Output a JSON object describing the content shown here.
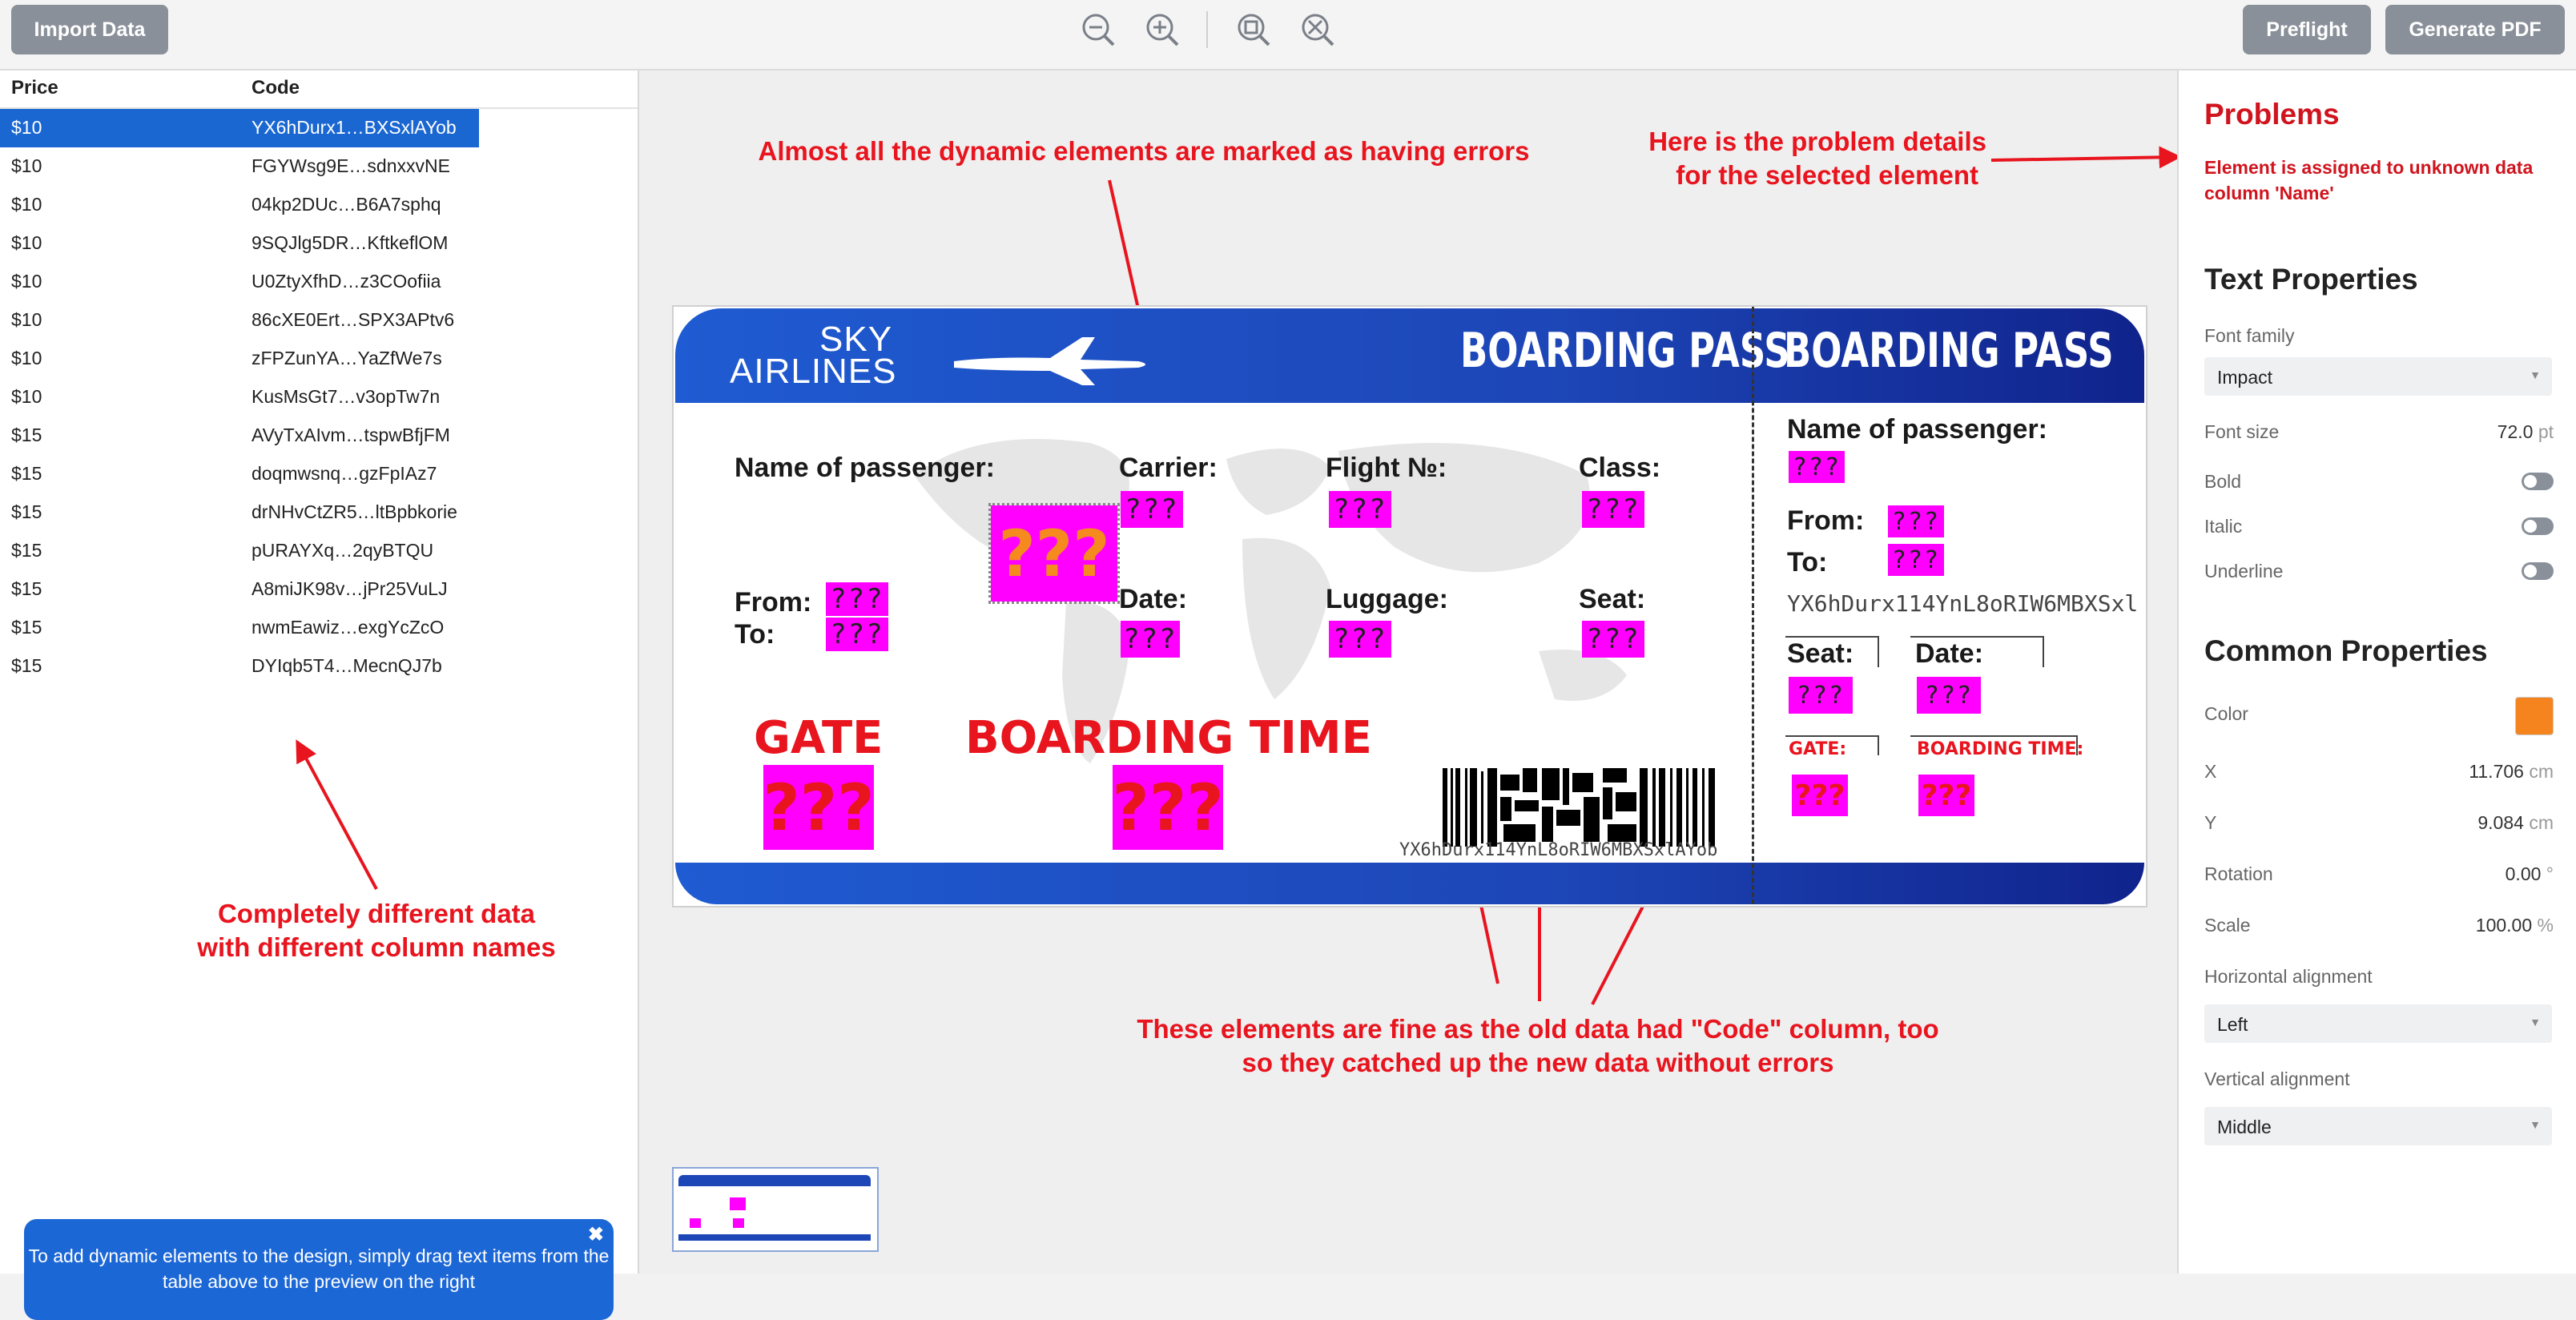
{
  "toolbar": {
    "import_label": "Import Data",
    "preflight_label": "Preflight",
    "generate_label": "Generate PDF",
    "icons": [
      "zoom-out-icon",
      "zoom-in-icon",
      "zoom-fit-icon",
      "zoom-actual-icon"
    ]
  },
  "table": {
    "headers": [
      "Price",
      "Code"
    ],
    "rows": [
      {
        "price": "$10",
        "code": "YX6hDurx1…BXSxlAYob"
      },
      {
        "price": "$10",
        "code": "FGYWsg9E…sdnxxvNE"
      },
      {
        "price": "$10",
        "code": "04kp2DUc…B6A7sphq"
      },
      {
        "price": "$10",
        "code": "9SQJlg5DR…KftkeflOM"
      },
      {
        "price": "$10",
        "code": "U0ZtyXfhD…z3COofiia"
      },
      {
        "price": "$10",
        "code": "86cXE0Ert…SPX3APtv6"
      },
      {
        "price": "$10",
        "code": "zFPZunYA…YaZfWe7s"
      },
      {
        "price": "$10",
        "code": "KusMsGt7…v3opTw7n"
      },
      {
        "price": "$15",
        "code": "AVyTxAIvm…tspwBfjFM"
      },
      {
        "price": "$15",
        "code": "doqmwsnq…gzFpIAz7"
      },
      {
        "price": "$15",
        "code": "drNHvCtZR5…ltBpbkorie"
      },
      {
        "price": "$15",
        "code": "pURAYXq…2qyBTQU"
      },
      {
        "price": "$15",
        "code": "A8miJK98v…jPr25VuLJ"
      },
      {
        "price": "$15",
        "code": "nwmEawiz…exgYcZcO"
      },
      {
        "price": "$15",
        "code": "DYIqb5T4…MecnQJ7b"
      }
    ],
    "selected_index": 0
  },
  "tip": {
    "text": "To add dynamic elements to the design, simply drag text items from the table above to the preview on the right",
    "close": "✖"
  },
  "annotations": {
    "errors": "Almost all the dynamic elements are marked as having errors",
    "problem_l1": "Here is the problem details",
    "problem_l2": "for the selected element",
    "data_l1": "Completely different data",
    "data_l2": "with different column names",
    "fine_l1": "These elements are fine as the old data had \"Code\" column, too",
    "fine_l2": "so they catched up the new data without errors"
  },
  "ticket": {
    "sky": "SKY",
    "airlines": "AIRLINES",
    "bp_main": "BOARDING PASS",
    "bp_stub": "BOARDING PASS",
    "name_label": "Name of passenger:",
    "carrier_label": "Carrier:",
    "flight_label": "Flight №:",
    "class_label": "Class:",
    "from_label": "From:",
    "to_label": "To:",
    "date_label": "Date:",
    "luggage_label": "Luggage:",
    "seat_label": "Seat:",
    "gate_label": "GATE",
    "boarding_time_label": "BOARDING TIME",
    "stub_gate": "GATE:",
    "stub_boarding": "BOARDING TIME:",
    "placeholder": "???",
    "barcode_text": "YX6hDurx114YnL8oRIW6MBXSxlAYob",
    "stub_code": "YX6hDurx114YnL8oRIW6MBXSxl"
  },
  "right": {
    "problems_title": "Problems",
    "problem_msg_l1": "Element is assigned to unknown data",
    "problem_msg_l2": "column 'Name'",
    "text_props_title": "Text Properties",
    "font_family_label": "Font family",
    "font_family_value": "Impact",
    "font_size_label": "Font size",
    "font_size_value": "72.0",
    "font_size_unit": "pt",
    "bold_label": "Bold",
    "italic_label": "Italic",
    "underline_label": "Underline",
    "common_title": "Common Properties",
    "color_label": "Color",
    "color_value": "#f5841f",
    "x_label": "X",
    "x_value": "11.706",
    "y_label": "Y",
    "y_value": "9.084",
    "len_unit": "cm",
    "rotation_label": "Rotation",
    "rotation_value": "0.00",
    "rotation_unit": "°",
    "scale_label": "Scale",
    "scale_value": "100.00",
    "scale_unit": "%",
    "halign_label": "Horizontal alignment",
    "halign_value": "Left",
    "valign_label": "Vertical alignment",
    "valign_value": "Middle"
  }
}
